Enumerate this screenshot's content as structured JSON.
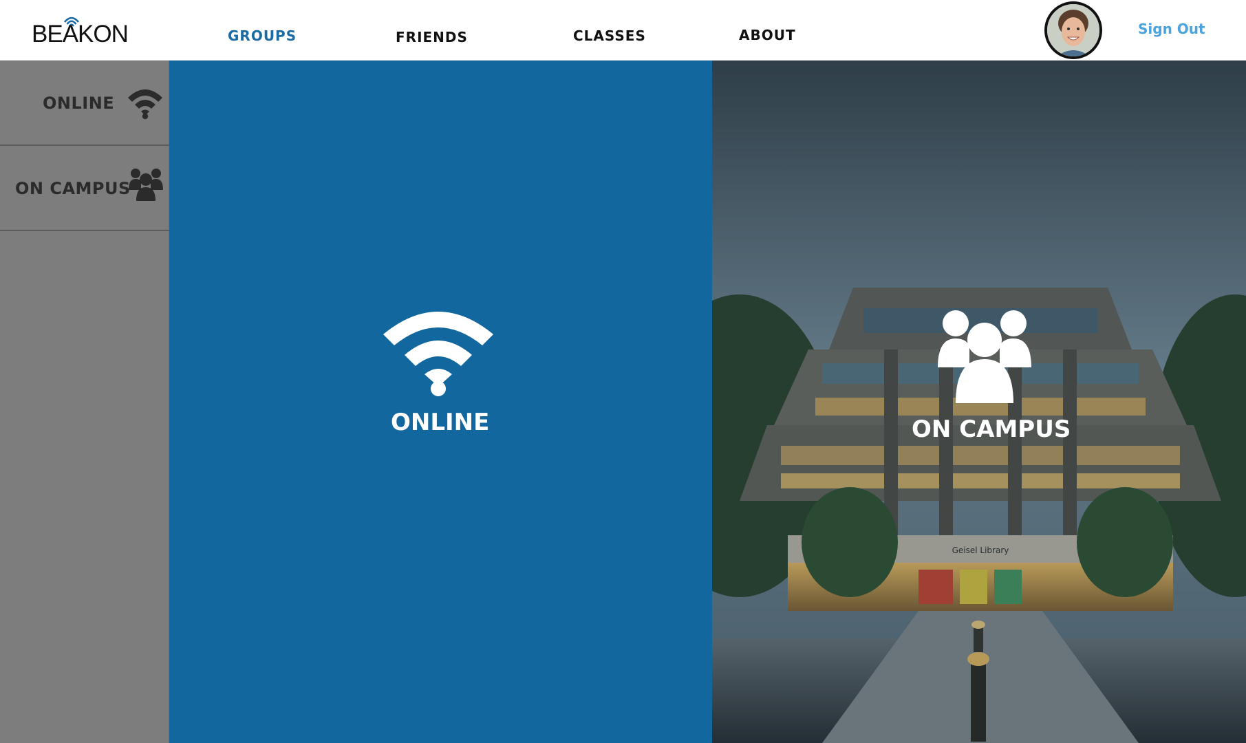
{
  "brand": {
    "name": "BEAKON",
    "accent": "#1a6aa3",
    "logo_icon": "signal-waves-icon"
  },
  "nav": {
    "items": [
      {
        "label": "GROUPS",
        "active": true
      },
      {
        "label": "FRIENDS",
        "active": false
      },
      {
        "label": "CLASSES",
        "active": false
      },
      {
        "label": "ABOUT",
        "active": false
      }
    ],
    "active_color": "#1a6aa3"
  },
  "user": {
    "avatar": "user-avatar",
    "sign_out_label": "Sign Out",
    "sign_out_color": "#4aa3dd"
  },
  "sidebar": {
    "items": [
      {
        "label": "ONLINE",
        "icon": "wifi-icon"
      },
      {
        "label": "ON CAMPUS",
        "icon": "group-icon"
      }
    ],
    "background": "#7d7d7d"
  },
  "main": {
    "online_panel": {
      "title": "ONLINE",
      "icon": "wifi-icon",
      "background": "#12679f"
    },
    "campus_panel": {
      "title": "ON CAMPUS",
      "icon": "group-icon",
      "background_image": "library-building-photo",
      "building_sign": "Geisel Library"
    }
  }
}
